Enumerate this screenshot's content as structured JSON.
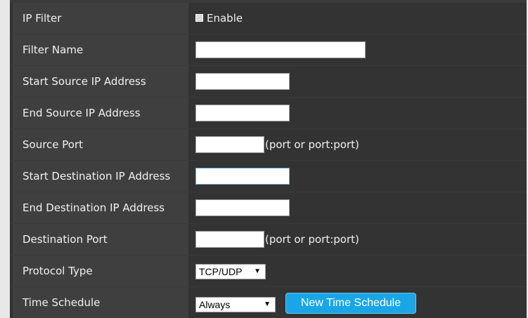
{
  "form": {
    "ip_filter": {
      "label": "IP Filter",
      "checkbox_label": "Enable",
      "checked": false
    },
    "filter_name": {
      "label": "Filter Name",
      "value": ""
    },
    "start_source_ip": {
      "label": "Start Source IP Address",
      "value": ""
    },
    "end_source_ip": {
      "label": "End Source IP Address",
      "value": ""
    },
    "source_port": {
      "label": "Source Port",
      "value": "",
      "hint": "(port or port:port)"
    },
    "start_dest_ip": {
      "label": "Start Destination IP Address",
      "value": ""
    },
    "end_dest_ip": {
      "label": "End Destination IP Address",
      "value": ""
    },
    "dest_port": {
      "label": "Destination Port",
      "value": "",
      "hint": "(port or port:port)"
    },
    "protocol_type": {
      "label": "Protocol Type",
      "selected": "TCP/UDP"
    },
    "time_schedule": {
      "label": "Time Schedule",
      "selected": "Always",
      "new_button": "New Time Schedule"
    }
  },
  "colors": {
    "panel_bg": "#333333",
    "label_bg": "#3f3f3f",
    "button_bg": "#1aa6e6",
    "text": "#f2f2f2"
  }
}
